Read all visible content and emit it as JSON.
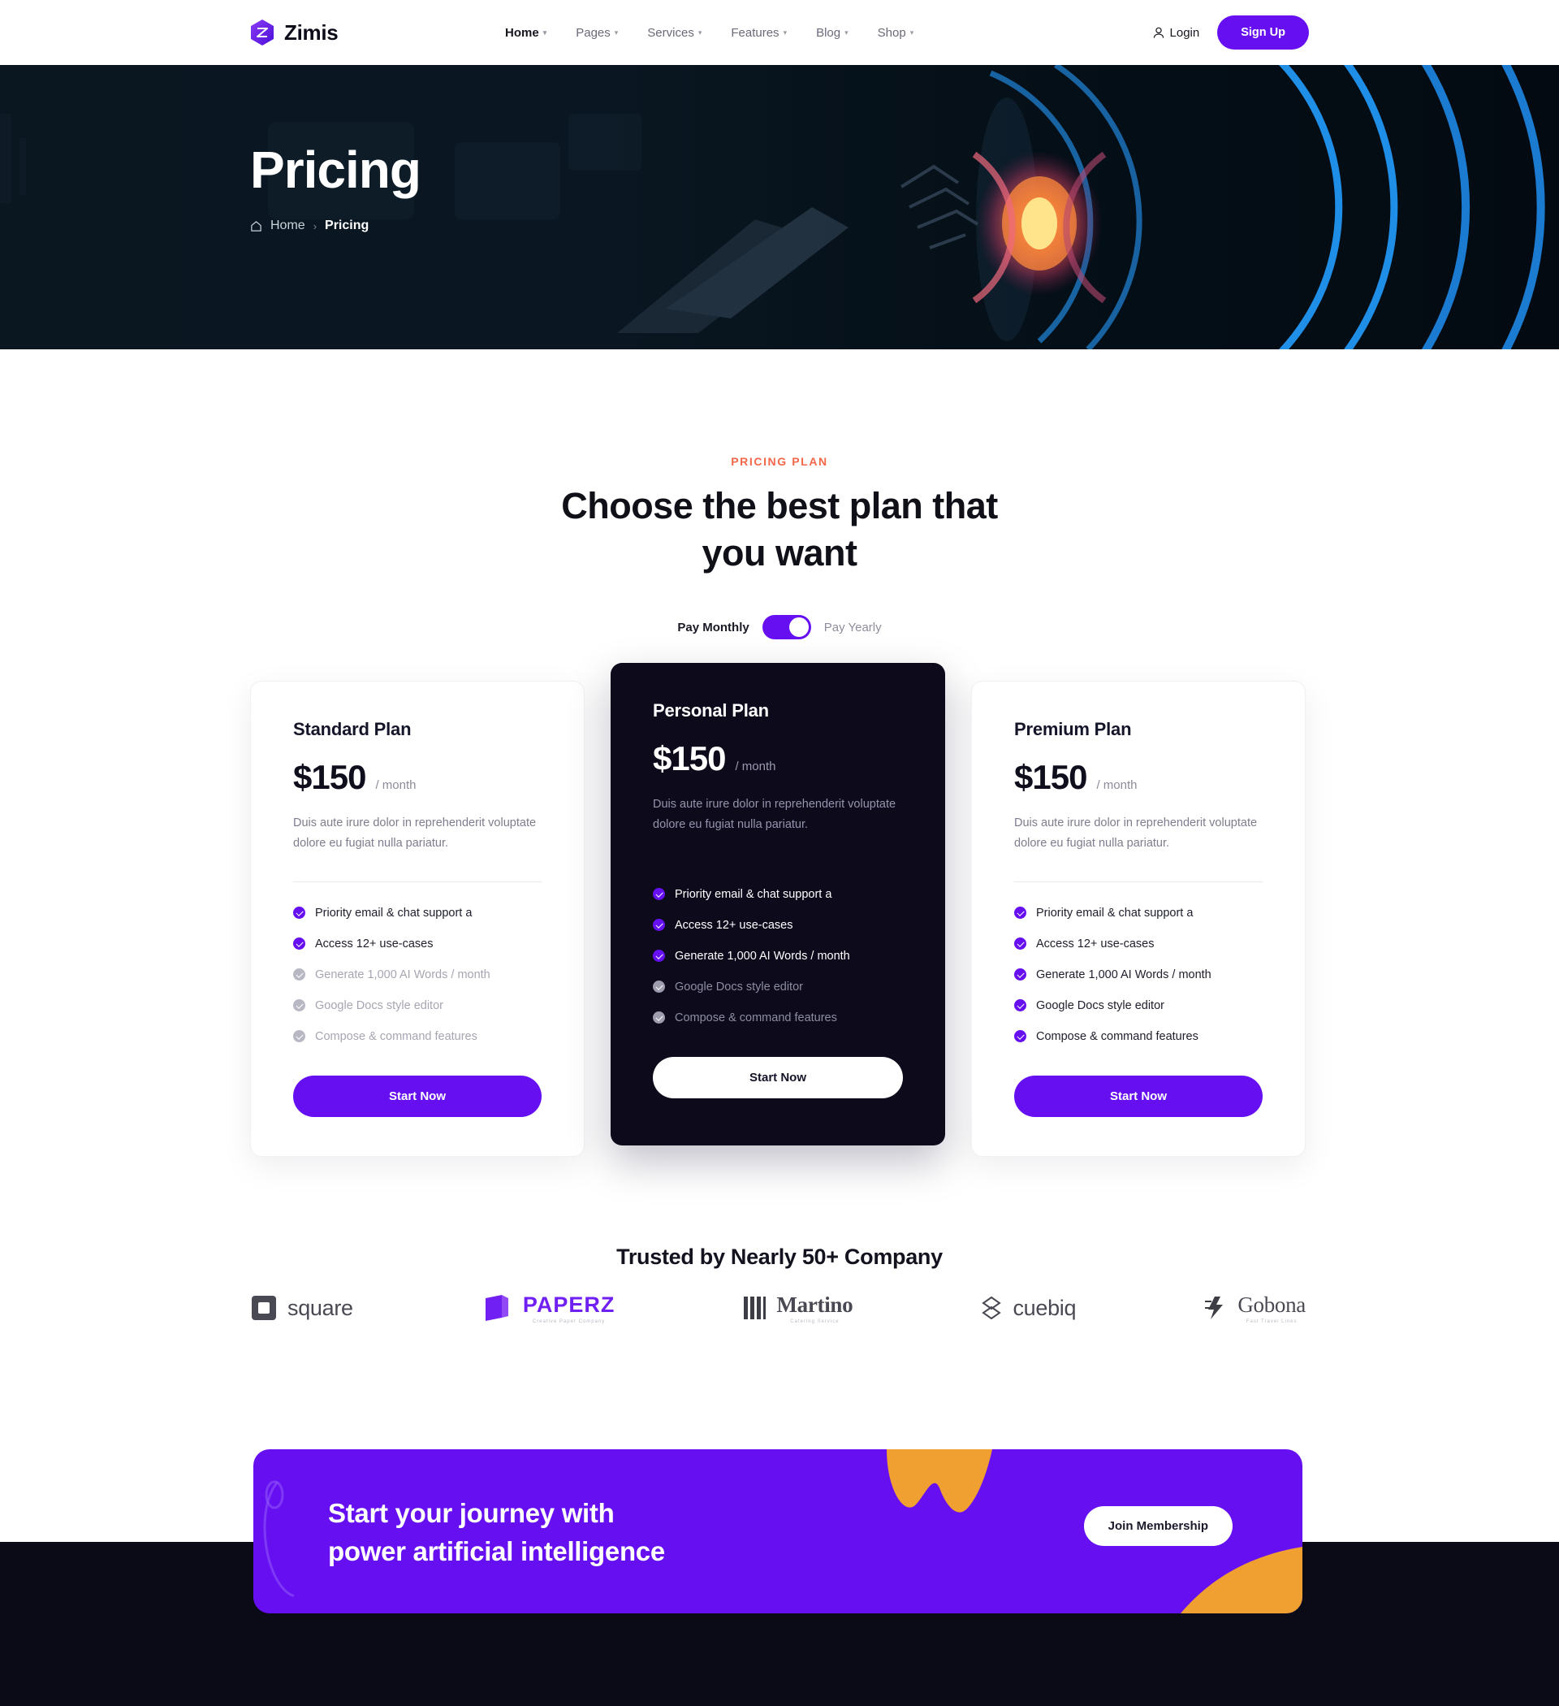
{
  "header": {
    "brand": "Zimis",
    "brand_icon": "zimis-hex-logo-icon",
    "nav": [
      {
        "label": "Home",
        "caret": "▾",
        "active": true
      },
      {
        "label": "Pages",
        "caret": "▾",
        "active": false
      },
      {
        "label": "Services",
        "caret": "▾",
        "active": false
      },
      {
        "label": "Features",
        "caret": "▾",
        "active": false
      },
      {
        "label": "Blog",
        "caret": "▾",
        "active": false
      },
      {
        "label": "Shop",
        "caret": "▾",
        "active": false
      }
    ],
    "login": "Login",
    "login_icon": "user-icon",
    "signup": "Sign Up"
  },
  "hero": {
    "title": "Pricing",
    "breadcrumb_home": "Home",
    "breadcrumb_sep": "›",
    "breadcrumb_current": "Pricing",
    "home_icon": "home-icon"
  },
  "pricing": {
    "eyebrow": "PRICING PLAN",
    "title_line1": "Choose the best plan that",
    "title_line2": "you want",
    "toggle": {
      "left_label": "Pay Monthly",
      "right_label": "Pay Yearly",
      "state": "yearly"
    },
    "plans": [
      {
        "name": "Standard Plan",
        "price": "$150",
        "period": "/ month",
        "desc": "Duis aute irure dolor in reprehenderit voluptate dolore eu fugiat nulla pariatur.",
        "features": [
          {
            "label": "Priority email & chat support a",
            "included": true
          },
          {
            "label": "Access 12+ use-cases",
            "included": true
          },
          {
            "label": "Generate 1,000 AI Words / month",
            "included": false
          },
          {
            "label": "Google Docs style editor",
            "included": false
          },
          {
            "label": "Compose & command features",
            "included": false
          }
        ],
        "button": "Start Now",
        "theme": "light"
      },
      {
        "name": "Personal Plan",
        "price": "$150",
        "period": "/ month",
        "desc": "Duis aute irure dolor in reprehenderit voluptate dolore eu fugiat nulla pariatur.",
        "features": [
          {
            "label": "Priority email & chat support a",
            "included": true
          },
          {
            "label": "Access 12+ use-cases",
            "included": true
          },
          {
            "label": "Generate 1,000 AI Words / month",
            "included": true
          },
          {
            "label": "Google Docs style editor",
            "included": false
          },
          {
            "label": "Compose & command features",
            "included": false
          }
        ],
        "button": "Start Now",
        "theme": "dark"
      },
      {
        "name": "Premium Plan",
        "price": "$150",
        "period": "/ month",
        "desc": "Duis aute irure dolor in reprehenderit voluptate dolore eu fugiat nulla pariatur.",
        "features": [
          {
            "label": "Priority email & chat support a",
            "included": true
          },
          {
            "label": "Access 12+ use-cases",
            "included": true
          },
          {
            "label": "Generate 1,000 AI Words / month",
            "included": true
          },
          {
            "label": "Google Docs style editor",
            "included": true
          },
          {
            "label": "Compose & command features",
            "included": true
          }
        ],
        "button": "Start Now",
        "theme": "light"
      }
    ]
  },
  "trusted": {
    "title": "Trusted by Nearly 50+ Company",
    "logos": [
      {
        "name": "square",
        "icon": "square-logo-icon",
        "sub": ""
      },
      {
        "name": "PAPERZ",
        "icon": "paperz-logo-icon",
        "sub": "Creative Paper Company"
      },
      {
        "name": "Martino",
        "icon": "martino-logo-icon",
        "sub": "Catering Service"
      },
      {
        "name": "cuebiq",
        "icon": "cuebiq-logo-icon",
        "sub": ""
      },
      {
        "name": "Gobona",
        "icon": "gobona-logo-icon",
        "sub": "Fast Travel Lines"
      }
    ]
  },
  "banner": {
    "line1": "Start your  journey with",
    "line2": "power artificial intelligence",
    "button": "Join Membership"
  },
  "colors": {
    "accent": "#6610f2",
    "eyebrow": "#f2684a",
    "dark": "#0d0a1c",
    "hero_bg": "#0a1620",
    "orange_blob": "#f0a030",
    "footer": "#0b0b18"
  }
}
